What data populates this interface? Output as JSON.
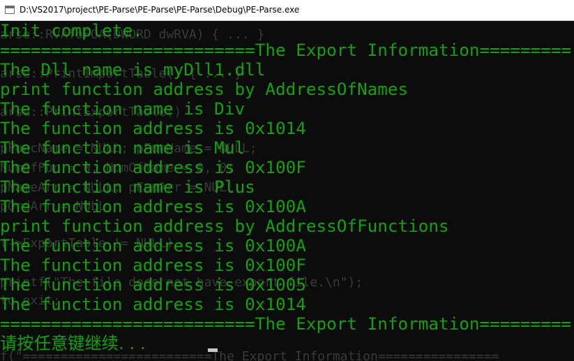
{
  "window": {
    "title": "D:\\VS2017\\project\\PE-Parse\\PE-Parse\\PE-Parse\\Debug\\PE-Parse.exe"
  },
  "console": {
    "text_color": "#13a10e",
    "background": "#0c0c0c",
    "lines": [
      "Init complete.",
      "=========================The Export Information=========",
      "The Dll name is myDll1.dll",
      "print function address by AddressOfNames",
      "The function name is Div",
      "The function address is 0x1014",
      "The function name is Mul",
      "The function address is 0x100F",
      "The function name is Plus",
      "The function address is 0x100A",
      "print function address by AddressOfFunctions",
      "The function address is 0x100A",
      "The function address is 0x100F",
      "The function address is 0x1005",
      "The function address is 0x1014",
      "=========================The Export Information=========",
      "请按任意键继续. . . "
    ]
  },
  "background_code": {
    "lines": [
      "arse::RVAToFOA(DWORD dwRVA) { ... }",
      "arse::PrintImportTable() { ... }",
      "arse::PrintExportTable()",
      "pFuncName = NULL; pFunName = NULL;",
      "NumOfFun = 0, NumOfName = 0, 0;",
      "pNameArr = NULL; pFunArr = NULL;",
      "pOrdArr = NULL;",
      "(->ExportTable != NULL)",
      "printf(\"The file does not have export file.\\n\");",
      "to exit;",
      "f(\"=========================The Export Information================"
    ]
  }
}
